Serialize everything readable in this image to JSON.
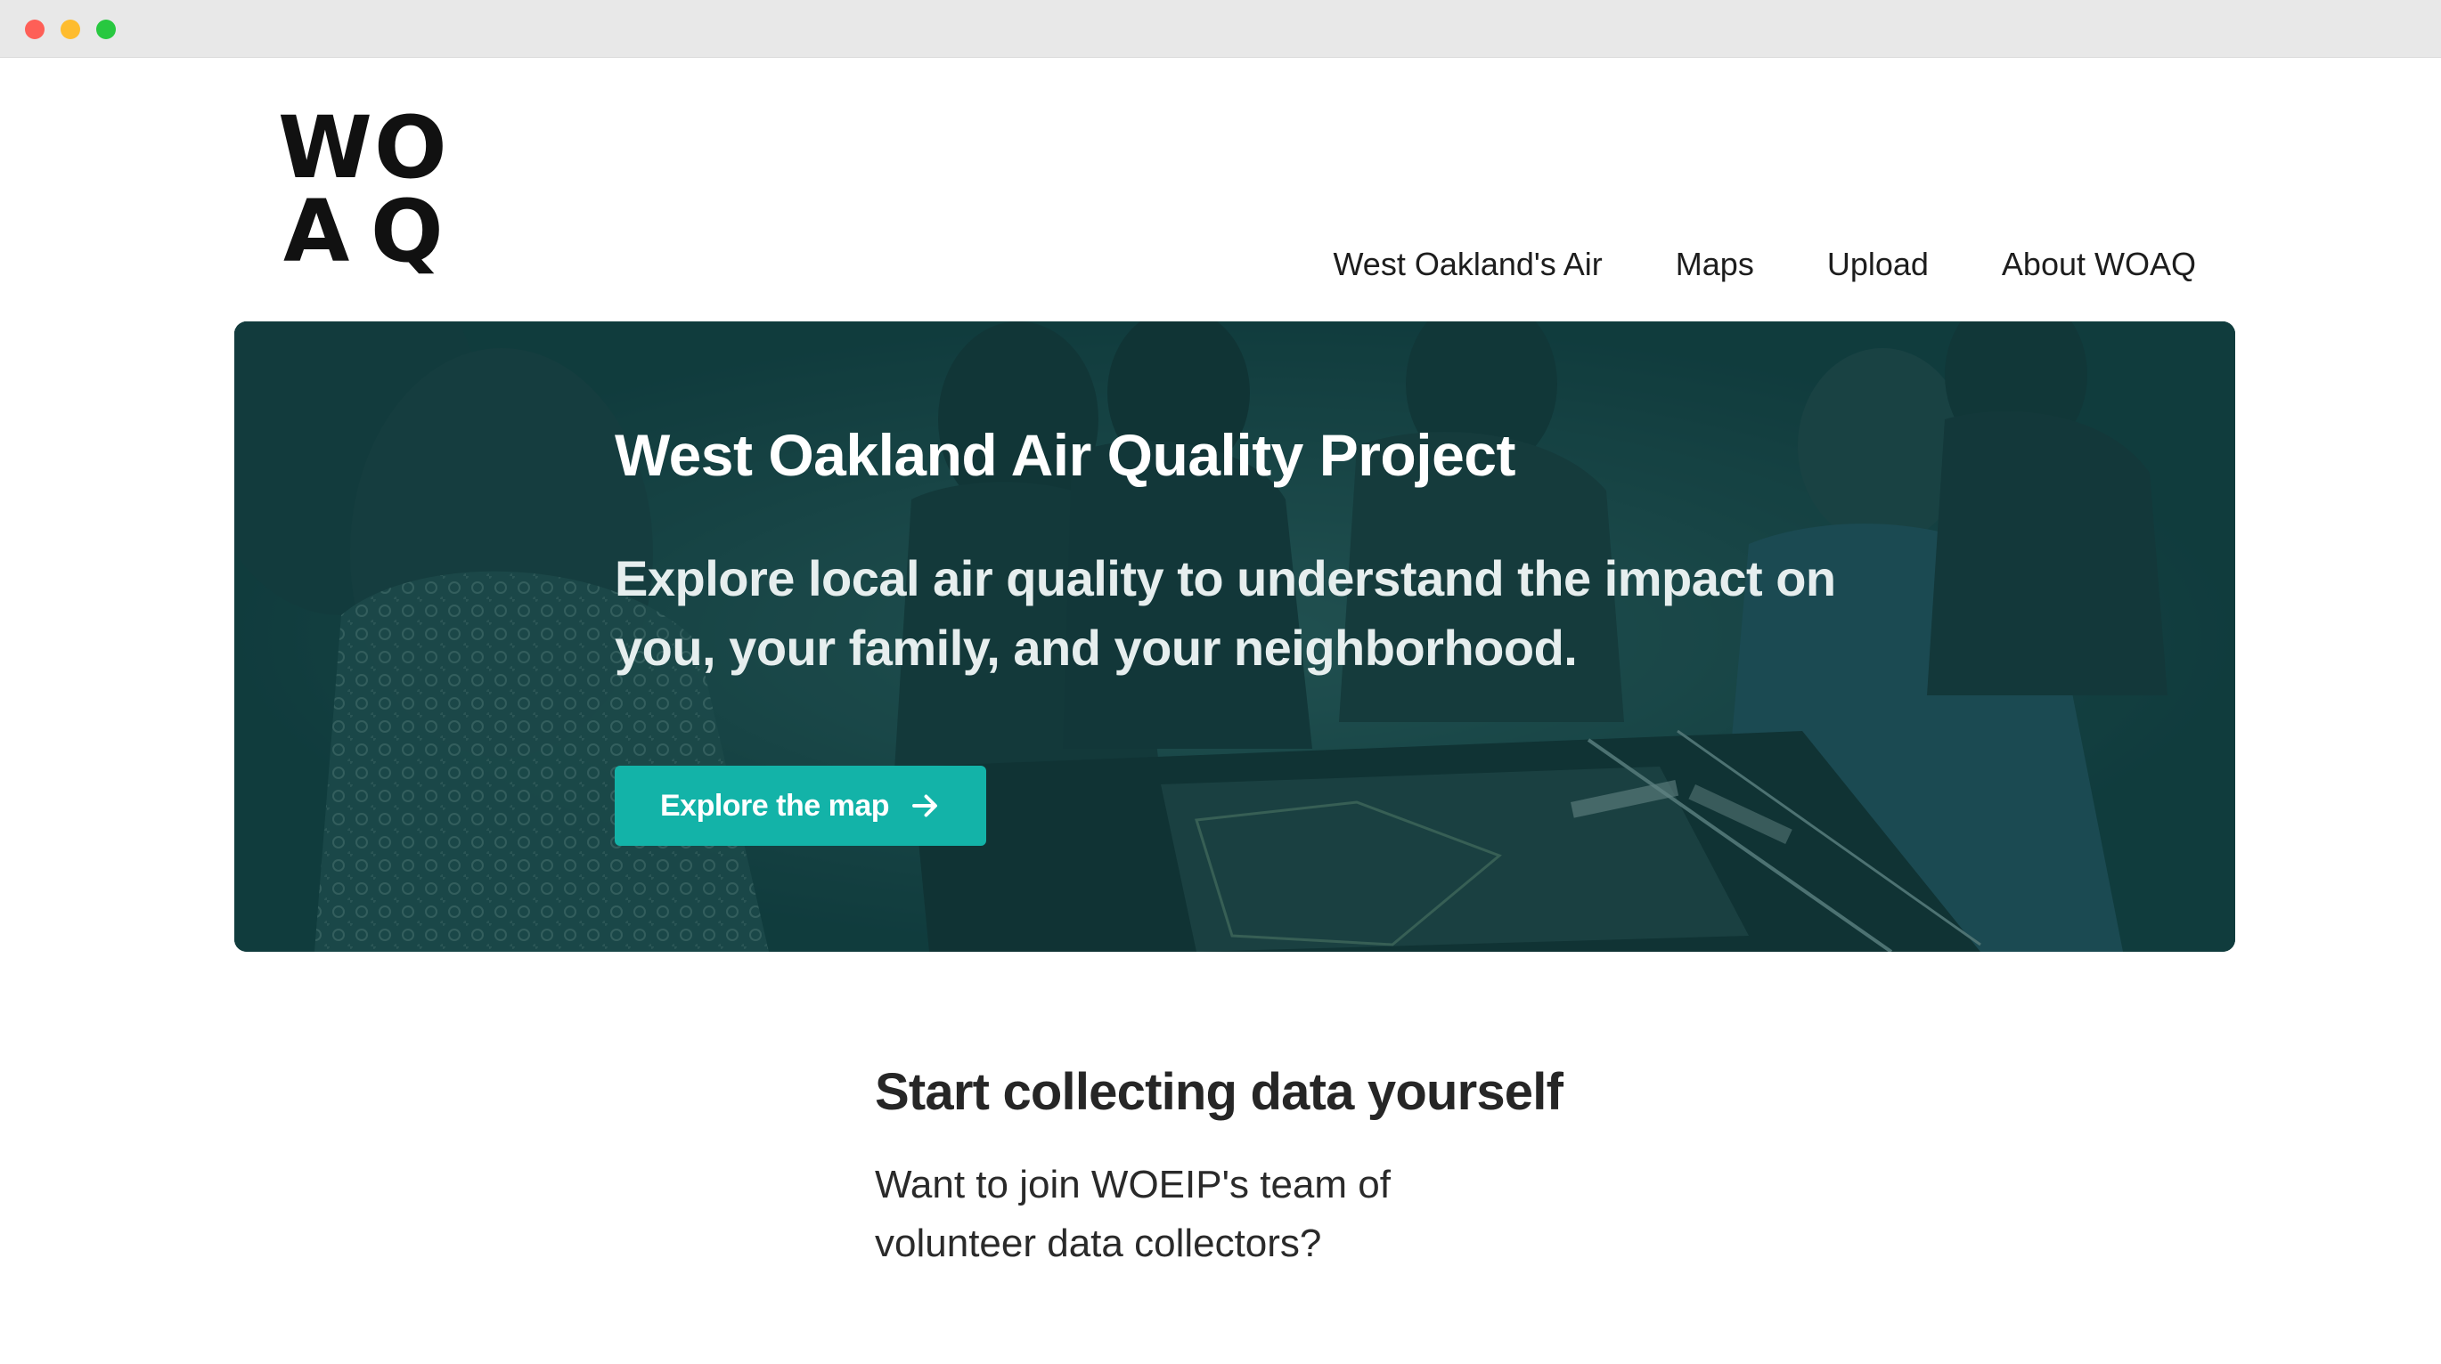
{
  "site": {
    "logo_letters": [
      "W",
      "O",
      "A",
      "Q"
    ]
  },
  "nav": {
    "items": [
      {
        "label": "West Oakland's Air"
      },
      {
        "label": "Maps"
      },
      {
        "label": "Upload"
      },
      {
        "label": "About WOAQ"
      }
    ]
  },
  "hero": {
    "title": "West Oakland Air Quality Project",
    "subtitle": "Explore local air quality to understand the impact on you, your family, and your neighborhood.",
    "cta_label": "Explore the map",
    "cta_icon": "arrow-right-icon",
    "overlay_color": "#0c3c3e",
    "cta_color": "#13b3a8"
  },
  "section": {
    "heading": "Start collecting data yourself",
    "body": "Want to join WOEIP's team of volunteer data collectors?"
  }
}
